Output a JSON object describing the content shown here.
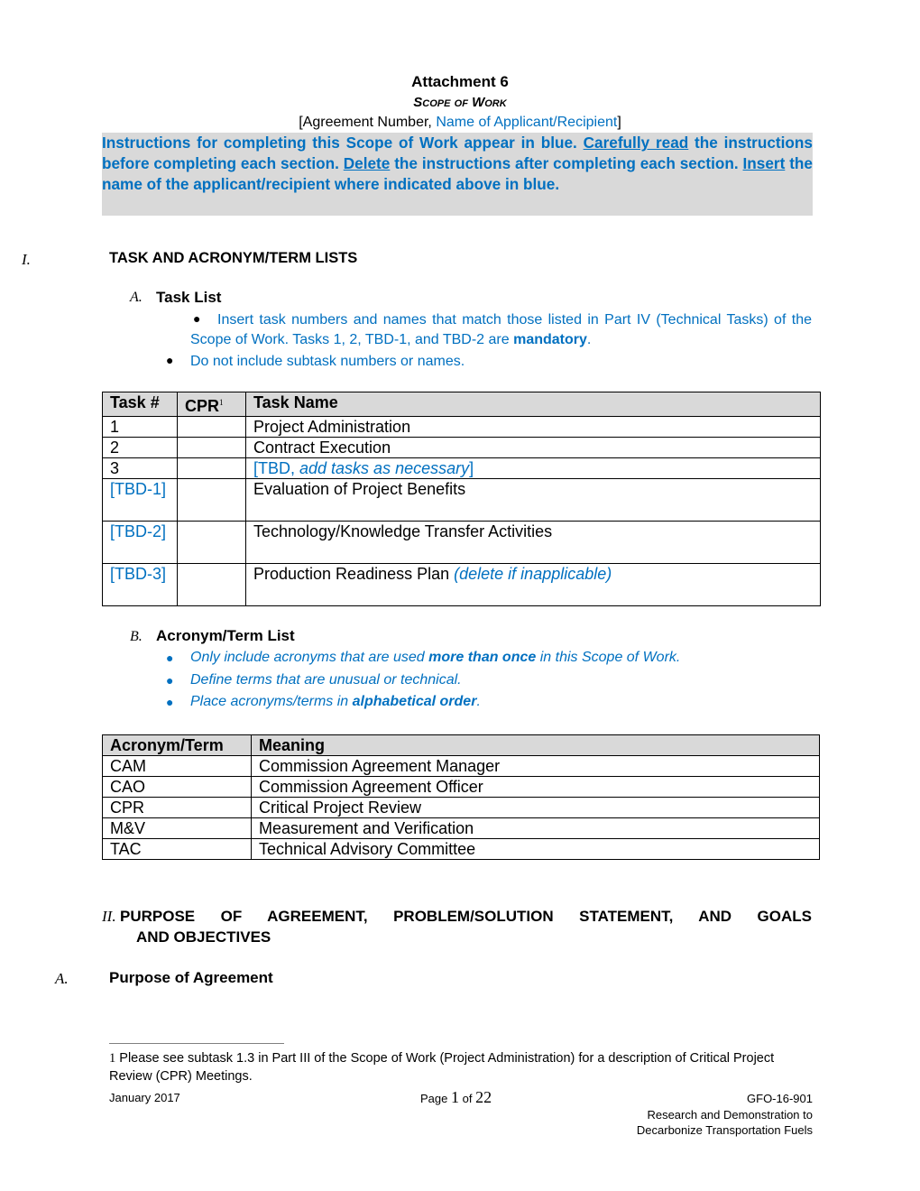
{
  "header": {
    "title": "Attachment 6",
    "subtitle": "Scope of Work",
    "agreement_open": "[Agreement Number, ",
    "agreement_name": "Name of Applicant/Recipient",
    "agreement_close": "]"
  },
  "instructions": {
    "part1": "Instructions for completing this Scope of Work appear in blue.  ",
    "link1": "Carefully read",
    "part2": " the instructions before completing each section.  ",
    "link2": "Delete",
    "part3": " the instructions after completing each section.  ",
    "link3": "Insert",
    "part4": " the name of the applicant/recipient where indicated above in blue."
  },
  "section1": {
    "number": "I.",
    "title": "TASK AND ACRONYM/TERM LISTS",
    "subsectionA": {
      "letter": "A.",
      "title": "Task List",
      "bullets": [
        {
          "text": "Insert task numbers and names that match those listed in Part IV (Technical Tasks) of the Scope of Work.  Tasks 1, 2, TBD-1, and TBD-2 are ",
          "bold": "mandatory",
          "end": "."
        },
        {
          "text": "Do not include subtask numbers or names."
        }
      ],
      "table": {
        "headers": [
          "Task #",
          "CPR",
          "Task Name"
        ],
        "cpr_footnote_ref": "1",
        "rows": [
          {
            "num": "1",
            "cpr": "",
            "name": "Project Administration",
            "note": ""
          },
          {
            "num": "2",
            "cpr": "",
            "name": "Contract Execution",
            "note": ""
          },
          {
            "num": "3",
            "cpr": "",
            "name": "[TBD, ",
            "note": "add tasks as necessary",
            "close": "]"
          },
          {
            "num": "[TBD-1]",
            "cpr": "",
            "name": "Evaluation of Project Benefits",
            "note": ""
          },
          {
            "num": "[TBD-2]",
            "cpr": "",
            "name": "Technology/Knowledge Transfer Activities",
            "note": ""
          },
          {
            "num": "[TBD-3]",
            "cpr": "",
            "name": "Production Readiness Plan ",
            "note": "(delete if inapplicable)"
          }
        ]
      }
    },
    "subsectionB": {
      "letter": "B.",
      "title": "Acronym/Term List",
      "bullets": [
        {
          "pre": "Only include acronyms that are used ",
          "bold": "more than once",
          "post": " in this Scope of Work."
        },
        {
          "pre": "Define terms that are unusual or technical.",
          "bold": "",
          "post": ""
        },
        {
          "pre": "Place acronyms/terms in ",
          "bold": "alphabetical order",
          "post": "."
        }
      ],
      "table": {
        "headers": [
          "Acronym/Term",
          "Meaning"
        ],
        "rows": [
          {
            "term": "CAM",
            "meaning": "Commission Agreement Manager"
          },
          {
            "term": "CAO",
            "meaning": "Commission Agreement Officer"
          },
          {
            "term": "CPR",
            "meaning": "Critical Project Review"
          },
          {
            "term": "M&V",
            "meaning": "Measurement and Verification"
          },
          {
            "term": "TAC",
            "meaning": "Technical Advisory Committee"
          }
        ]
      }
    }
  },
  "section2": {
    "number": "II.",
    "title_line1": "PURPOSE OF AGREEMENT, PROBLEM/SOLUTION STATEMENT, AND GOALS",
    "title_line2": "AND OBJECTIVES",
    "subsectionA": {
      "letter": "A.",
      "title": "Purpose of Agreement"
    }
  },
  "footnote": {
    "number": "1",
    "text": " Please see subtask 1.3 in Part III of the Scope of Work (Project Administration) for a description of Critical Project Review (CPR) Meetings."
  },
  "footer": {
    "date": "January 2017",
    "page_label": "Page ",
    "page_current": "1",
    "page_of": " of ",
    "page_total": "22",
    "solicitation": "GFO-16-901",
    "program_line1": "Research and Demonstration to",
    "program_line2": "Decarbonize Transportation Fuels"
  }
}
